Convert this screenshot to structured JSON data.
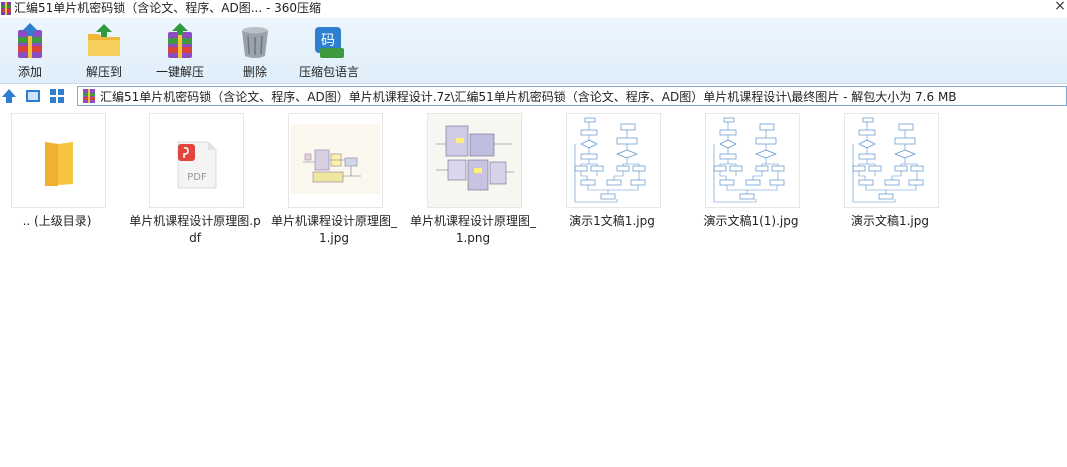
{
  "window": {
    "title": "汇编51单片机密码锁（含论文、程序、AD图... - 360压缩",
    "close_glyph": "×"
  },
  "toolbar": {
    "buttons": [
      {
        "label": "添加",
        "icon": "add-archive-icon"
      },
      {
        "label": "解压到",
        "icon": "extract-to-icon"
      },
      {
        "label": "一键解压",
        "icon": "one-click-extract-icon"
      },
      {
        "label": "删除",
        "icon": "delete-trash-icon"
      },
      {
        "label": "压缩包语言",
        "icon": "archive-language-icon"
      }
    ],
    "language_badge": "码"
  },
  "address": {
    "path": "汇编51单片机密码锁（含论文、程序、AD图）单片机课程设计.7z\\汇编51单片机密码锁（含论文、程序、AD图）单片机课程设计\\最终图片 - 解包大小为 7.6 MB"
  },
  "files": [
    {
      "name": ".. (上级目录)",
      "type": "parent-folder"
    },
    {
      "name": "单片机课程设计原理图.pdf",
      "type": "pdf"
    },
    {
      "name": "单片机课程设计原理图_1.jpg",
      "type": "jpg"
    },
    {
      "name": "单片机课程设计原理图_1.png",
      "type": "png"
    },
    {
      "name": "演示1文稿1.jpg",
      "type": "flowchart"
    },
    {
      "name": "演示文稿1(1).jpg",
      "type": "flowchart"
    },
    {
      "name": "演示文稿1.jpg",
      "type": "flowchart"
    }
  ],
  "pdf_badge_text": "PDF",
  "colors": {
    "toolbar_bg": "#dfeefa",
    "path_border": "#7fa7cf",
    "pdf_red": "#e2453c",
    "folder_yellow": "#f5c542",
    "flowchart_blue": "#5a8fc9"
  }
}
